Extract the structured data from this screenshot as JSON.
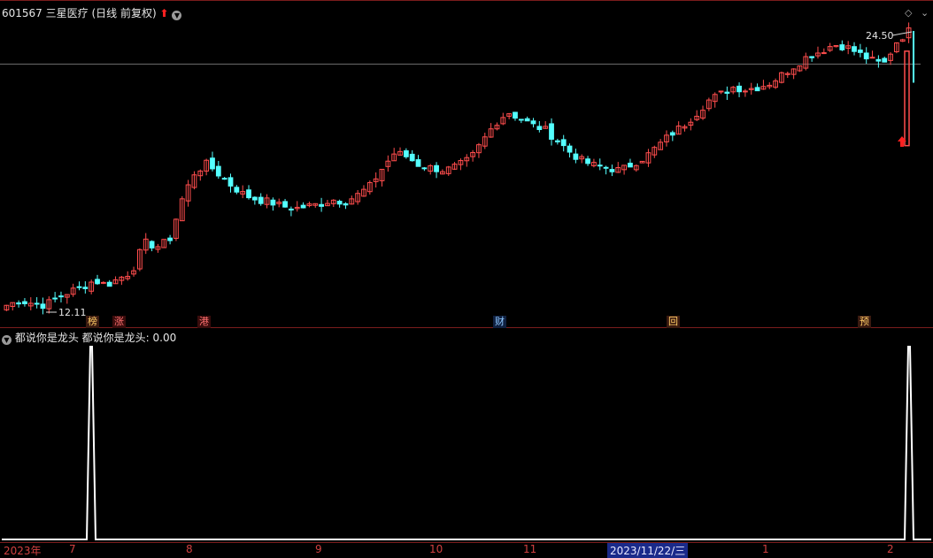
{
  "header": {
    "stock_code": "601567",
    "stock_name": "三星医疗",
    "period_label": "(日线 前复权)",
    "indicator_name": "都说你是龙头",
    "indicator_value_label": "都说你是龙头: 0.00"
  },
  "annotations": {
    "high_label": "24.50",
    "low_label": "12.11"
  },
  "badges": [
    {
      "text": "榜",
      "style": "gold"
    },
    {
      "text": "涨",
      "style": "red"
    },
    {
      "text": "港",
      "style": "red"
    },
    {
      "text": "财",
      "style": "blue"
    },
    {
      "text": "回",
      "style": "gold"
    },
    {
      "text": "预",
      "style": "gold"
    }
  ],
  "x_axis_labels": [
    "2023年",
    "7",
    "8",
    "9",
    "10",
    "11",
    "2023/11/22/三",
    "1",
    "2"
  ],
  "colors": {
    "up": "#ff4d4d",
    "down": "#54ffff",
    "background": "#000000",
    "indicator": "#ffffff",
    "axis_text": "#d04040"
  },
  "chart_data": [
    {
      "type": "candlestick",
      "title": "601567 三星医疗 (日线 前复权)",
      "price_range": [
        12.11,
        24.5
      ],
      "series": [
        {
          "name": "close",
          "approx_values": [
            12.3,
            12.5,
            12.4,
            12.3,
            12.6,
            12.9,
            13.1,
            13.4,
            13.2,
            13.5,
            13.8,
            15.1,
            14.9,
            15.2,
            17.0,
            18.2,
            18.6,
            18.1,
            17.6,
            17.2,
            17.0,
            16.9,
            16.7,
            16.6,
            16.7,
            16.8,
            17.0,
            16.9,
            17.2,
            17.6,
            18.4,
            19.1,
            18.9,
            18.5,
            18.4,
            18.3,
            18.5,
            18.8,
            19.6,
            20.4,
            20.9,
            20.6,
            20.3,
            20.1,
            19.6,
            19.1,
            18.7,
            18.5,
            18.4,
            18.3,
            18.6,
            18.9,
            19.4,
            19.9,
            20.3,
            20.8,
            21.4,
            21.7,
            22.0,
            21.9,
            22.0,
            22.2,
            22.6,
            23.0,
            23.4,
            23.6,
            23.9,
            23.8,
            23.5,
            23.2,
            23.0,
            24.0,
            24.5
          ]
        }
      ]
    },
    {
      "type": "line",
      "title": "都说你是龙头",
      "series": [
        {
          "name": "都说你是龙头",
          "peaks": [
            {
              "at": "7",
              "value": 1
            },
            {
              "at": "2",
              "value": 1
            }
          ],
          "current": 0.0
        }
      ]
    }
  ]
}
